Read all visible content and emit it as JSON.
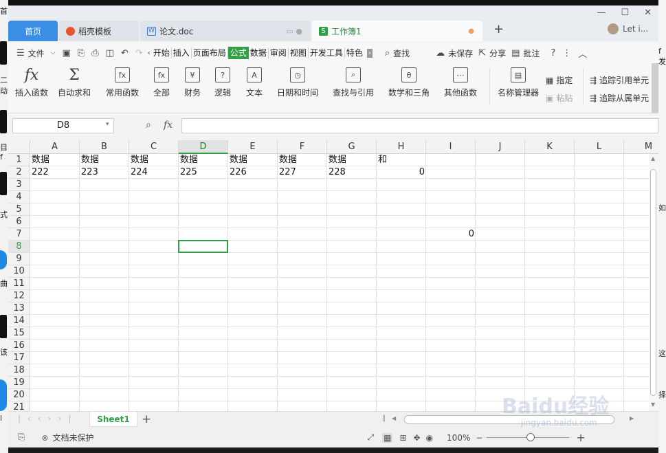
{
  "desktop": {
    "left_glyphs": [
      "首",
      "二",
      "动",
      "目",
      "f",
      "式",
      "曲",
      "该",
      "l"
    ],
    "right_glyphs": [
      "f发",
      "如",
      "这",
      "择"
    ]
  },
  "window": {
    "tabs": [
      {
        "label": "首页"
      },
      {
        "label": "稻壳模板"
      },
      {
        "label": "论文.doc"
      },
      {
        "label": "工作簿1"
      }
    ],
    "new_tab": "+",
    "user": "Let i...",
    "controls": [
      "—",
      "☐",
      "✕"
    ]
  },
  "menubar": {
    "file": "文件",
    "items": [
      "开始",
      "插入",
      "页面布局",
      "公式",
      "数据",
      "审阅",
      "视图",
      "开发工具",
      "特色"
    ],
    "active": "公式",
    "search": "查找",
    "unsaved": "未保存",
    "share": "分享",
    "comment": "批注"
  },
  "ribbon": {
    "buttons": [
      "插入函数",
      "自动求和",
      "常用函数",
      "全部",
      "财务",
      "逻辑",
      "文本",
      "日期和时间",
      "查找与引用",
      "数学和三角",
      "其他函数",
      "名称管理器"
    ],
    "small": {
      "assign": "指定",
      "paste": "粘贴",
      "trace_prec": "追踪引用单元",
      "trace_dep": "追踪从属单元"
    }
  },
  "formulabar": {
    "name_box": "D8",
    "fx": "fx",
    "formula": ""
  },
  "grid": {
    "columns": [
      "A",
      "B",
      "C",
      "D",
      "E",
      "F",
      "G",
      "H",
      "I",
      "J",
      "K",
      "L",
      "M"
    ],
    "selected_col": "D",
    "rows": [
      "1",
      "2",
      "3",
      "4",
      "5",
      "6",
      "7",
      "8",
      "9",
      "10",
      "11",
      "12",
      "13",
      "14",
      "15",
      "16",
      "17",
      "18",
      "19",
      "20",
      "21"
    ],
    "selected_row": "8",
    "cells": {
      "A1": "数据",
      "B1": "数据",
      "C1": "数据",
      "D1": "数据",
      "E1": "数据",
      "F1": "数据",
      "G1": "数据",
      "H1": "和",
      "A2": "222",
      "B2": "223",
      "C2": "224",
      "D2": "225",
      "E2": "226",
      "F2": "227",
      "G2": "228",
      "H2": "0",
      "I7": "0"
    }
  },
  "sheetbar": {
    "sheet": "Sheet1",
    "add": "+"
  },
  "statusbar": {
    "protect": "文档未保护",
    "zoom": "100%"
  },
  "watermark": {
    "main": "Baidu经验",
    "sub": "jingyan.baidu.com"
  }
}
